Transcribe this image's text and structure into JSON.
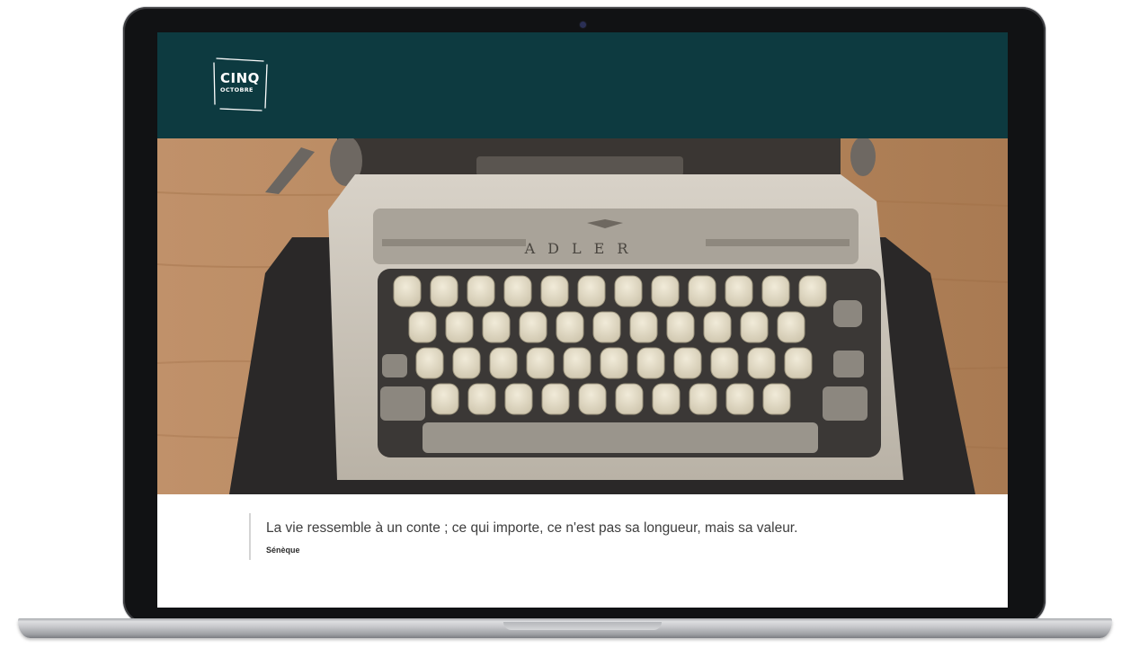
{
  "site": {
    "logo_line1": "CINQ",
    "logo_line2": "OCTOBRE",
    "header_color": "#0d3a40"
  },
  "hero": {
    "typewriter_brand": "ADLER"
  },
  "quote": {
    "text": "La vie ressemble à un conte ; ce qui importe, ce n'est pas sa longueur, mais sa valeur.",
    "author": "Sénèque"
  },
  "icons": {
    "webcam": "camera-icon"
  }
}
